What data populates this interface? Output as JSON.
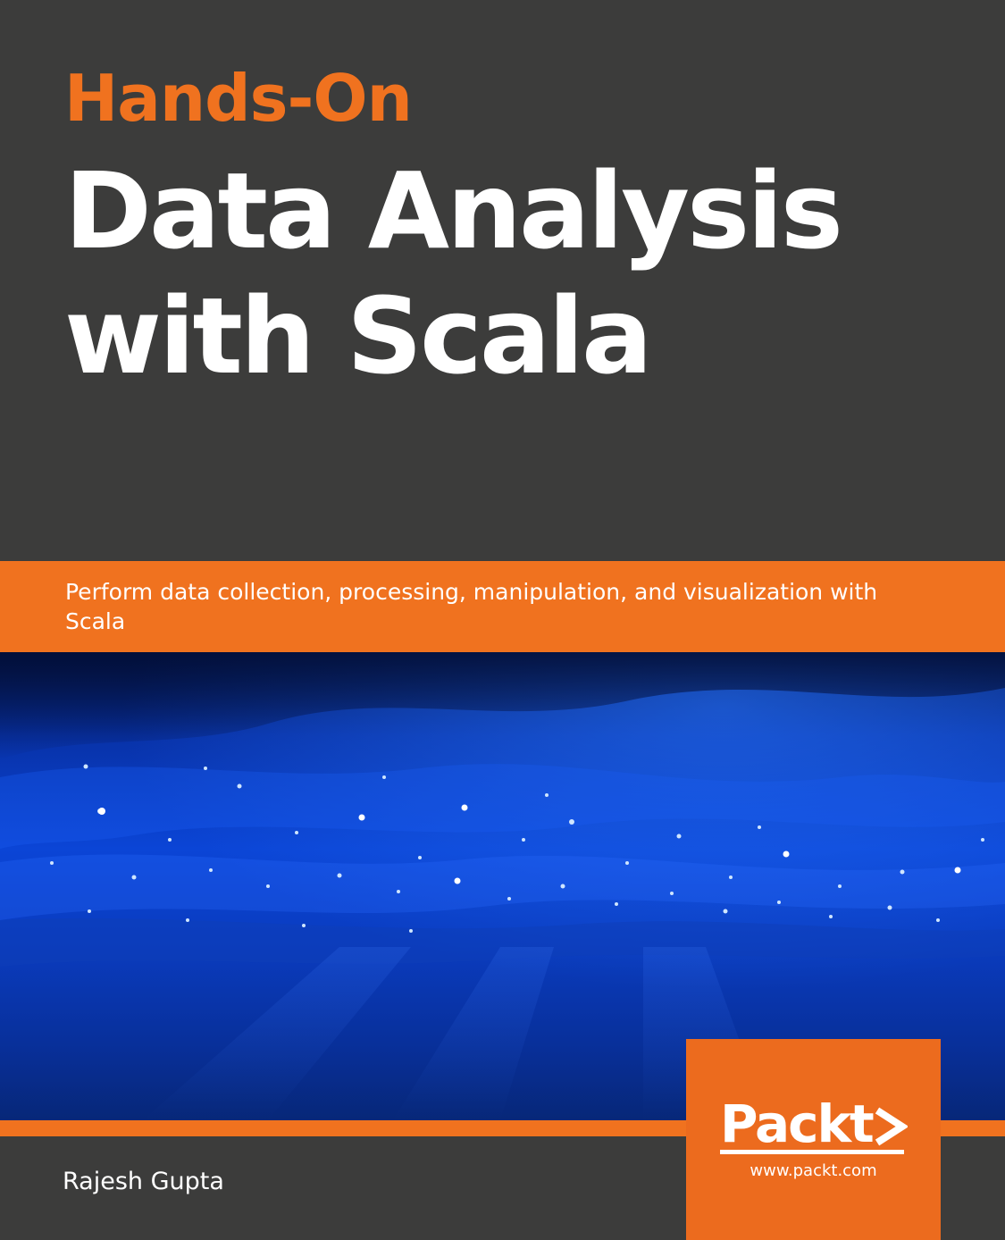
{
  "cover": {
    "series": "Hands-On",
    "title_lines": [
      "Data Analysis",
      "with Scala"
    ],
    "subtitle": "Perform data collection, processing, manipulation, and visualization with Scala",
    "author": "Rajesh Gupta",
    "publisher": {
      "logo_text": "Packt",
      "url": "www.packt.com"
    },
    "image": "underwater-sparkle-image"
  },
  "colors": {
    "background": "#3c3c3b",
    "accent_orange": "#f0721f",
    "title_white": "#ffffff",
    "water_blue": "#0a3fc4"
  }
}
